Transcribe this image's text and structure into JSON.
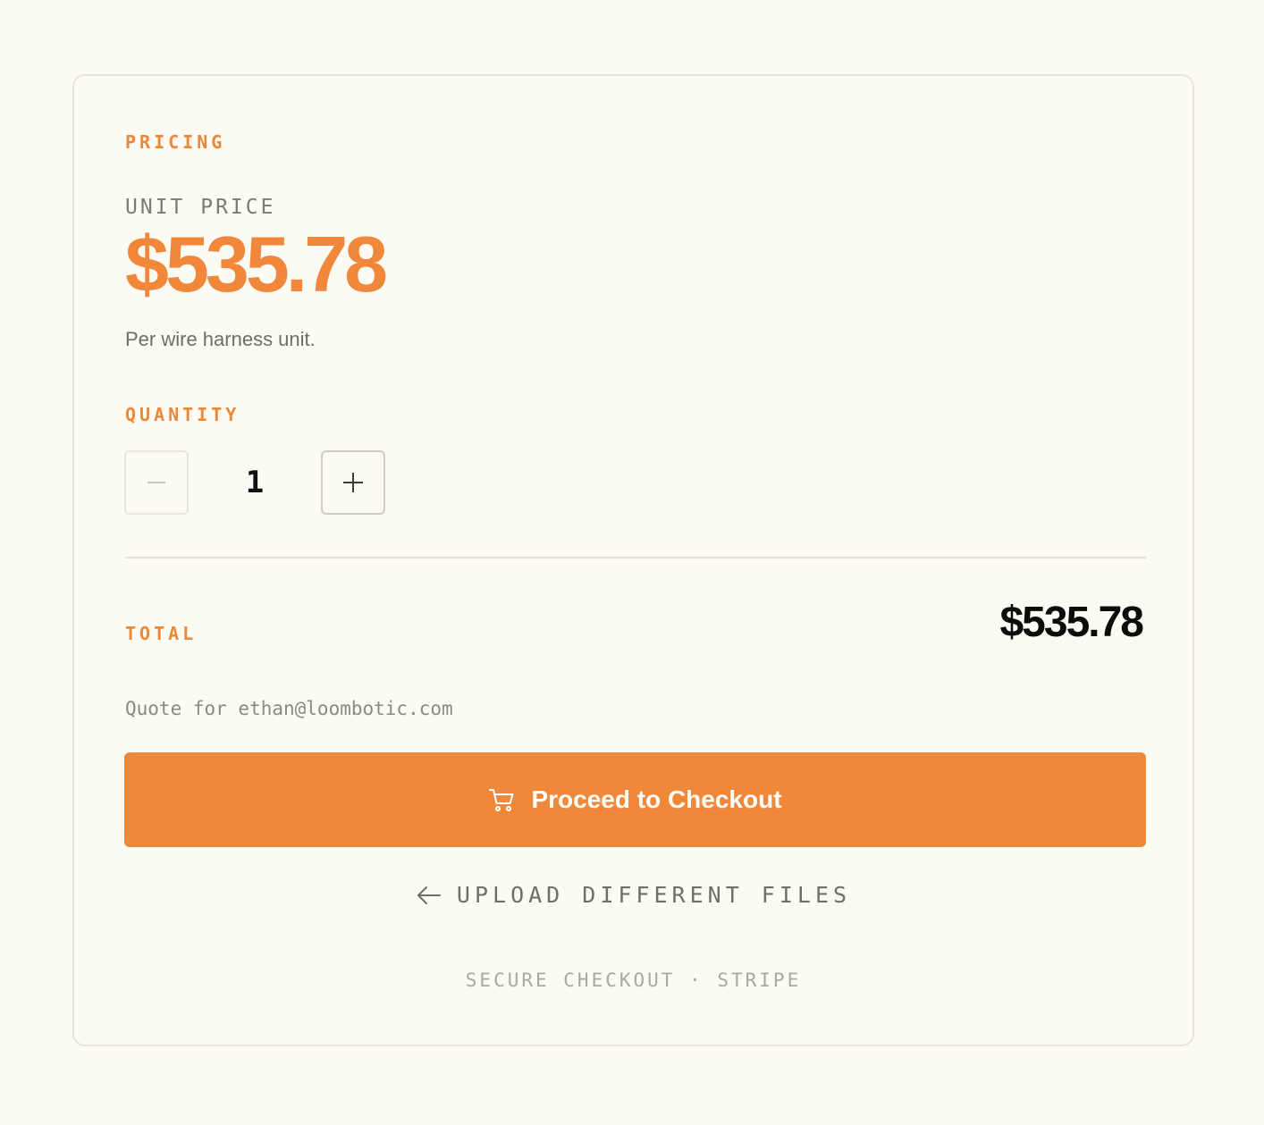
{
  "pricing": {
    "section_label": "PRICING",
    "unit_price_label": "UNIT PRICE",
    "unit_price": "$535.78",
    "unit_note": "Per wire harness unit."
  },
  "quantity": {
    "section_label": "QUANTITY",
    "value": "1",
    "decrement_icon": "minus-icon",
    "increment_icon": "plus-icon"
  },
  "total": {
    "label": "TOTAL",
    "value": "$535.78"
  },
  "quote": {
    "text": "Quote for ethan@loombotic.com"
  },
  "actions": {
    "checkout_label": "Proceed to Checkout",
    "checkout_icon": "cart-icon",
    "upload_label": "UPLOAD DIFFERENT FILES",
    "upload_icon": "arrow-left-icon"
  },
  "footer": {
    "note": "SECURE CHECKOUT · STRIPE"
  },
  "colors": {
    "accent": "#f0883a",
    "background": "#fbfaf3"
  }
}
